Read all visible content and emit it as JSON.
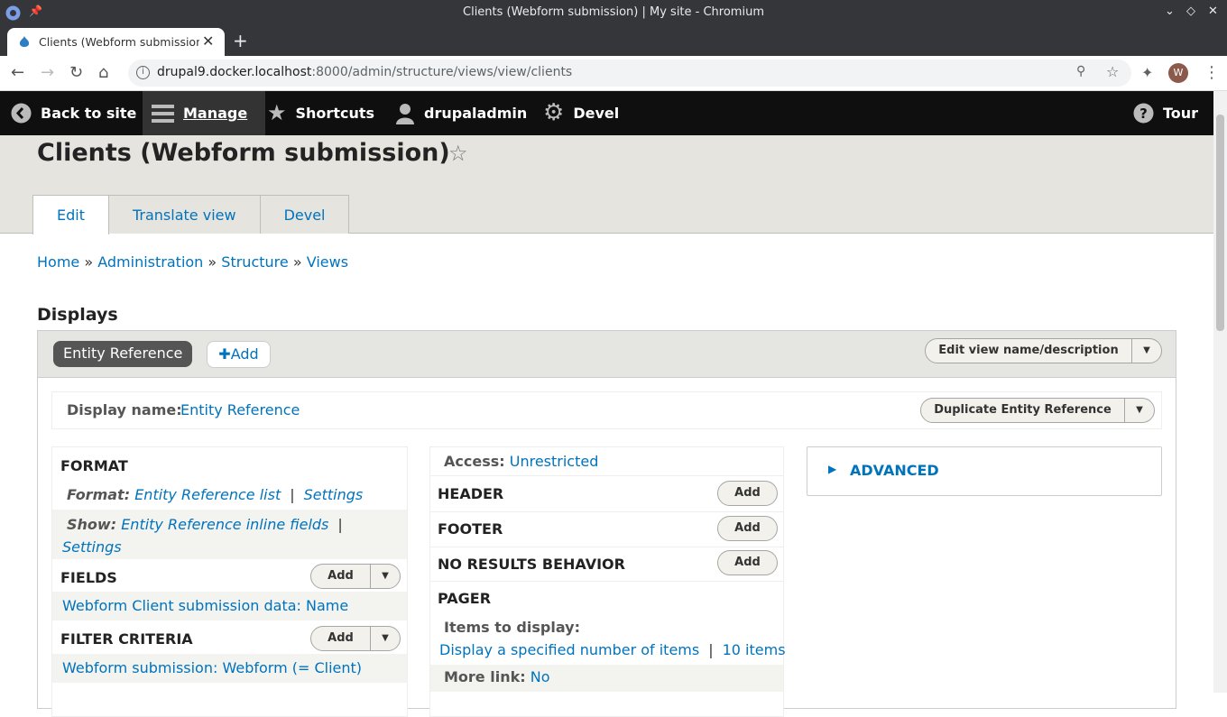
{
  "window": {
    "title": "Clients (Webform submission) | My site - Chromium"
  },
  "tab": {
    "label": "Clients (Webform submission",
    "close": "✕",
    "new": "+"
  },
  "address": {
    "host": "drupal9.docker.localhost",
    "path": ":8000/admin/structure/views/view/clients",
    "avatar": "W"
  },
  "toolbar": {
    "back_to_site": "Back to site",
    "manage": "Manage",
    "shortcuts": "Shortcuts",
    "user": "drupaladmin",
    "devel": "Devel",
    "tour": "Tour"
  },
  "page": {
    "title": "Clients (Webform submission)",
    "tabs": [
      "Edit",
      "Translate view",
      "Devel"
    ]
  },
  "breadcrumb": [
    "Home",
    "Administration",
    "Structure",
    "Views"
  ],
  "breadcrumb_sep": "»",
  "displays": {
    "heading": "Displays",
    "active_display": "Entity Reference",
    "add_label": "Add",
    "edit_view_name": "Edit view name/description",
    "display_name_label": "Display name:",
    "display_name_value": "Entity Reference",
    "duplicate_label": "Duplicate Entity Reference"
  },
  "left": {
    "format_heading": "FORMAT",
    "format_label": "Format:",
    "format_value": "Entity Reference list",
    "format_settings": "Settings",
    "show_label": "Show:",
    "show_value": "Entity Reference inline fields",
    "show_settings": "Settings",
    "fields_heading": "FIELDS",
    "fields_item": "Webform Client submission data: Name",
    "filter_heading": "FILTER CRITERIA",
    "filter_item": "Webform submission: Webform (= Client)",
    "add": "Add"
  },
  "middle": {
    "access_label": "Access:",
    "access_value": "Unrestricted",
    "header": "HEADER",
    "footer": "FOOTER",
    "no_results": "NO RESULTS BEHAVIOR",
    "pager": "PAGER",
    "items_label": "Items to display:",
    "items_value": "Display a specified number of items",
    "items_count": "10 items",
    "more_link_label": "More link:",
    "more_link_value": "No",
    "add": "Add"
  },
  "advanced": {
    "label": "ADVANCED"
  },
  "colors": {
    "link": "#0073bd",
    "toolbar": "#0f0f0f",
    "header_bg": "#e6e4df"
  }
}
